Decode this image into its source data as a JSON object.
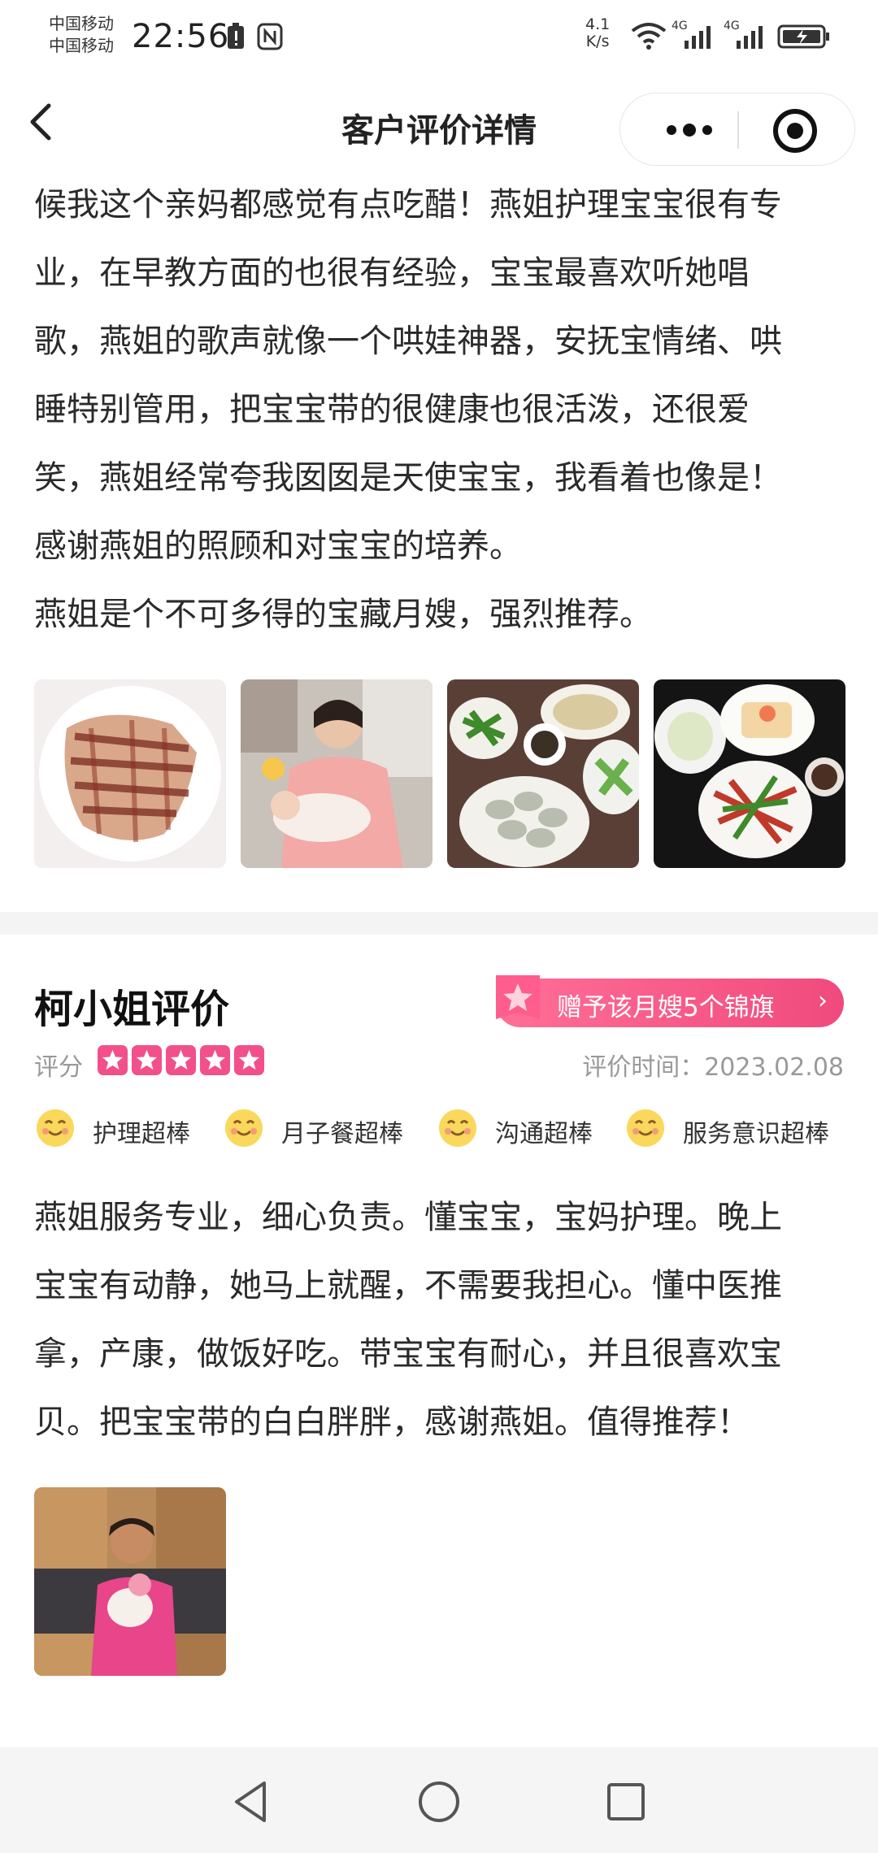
{
  "status_bar": {
    "carrier_1": "中国移动",
    "carrier_2": "中国移动",
    "time": "22:56",
    "net_speed_value": "4.1",
    "net_speed_unit": "K/s",
    "signal_1_label": "4G",
    "signal_2_label": "4G"
  },
  "nav": {
    "title": "客户评价详情",
    "back_icon": "chevron-left-icon",
    "more_icon": "more-dots-icon",
    "close_icon": "target-icon"
  },
  "review_1": {
    "lines": [
      "候我这个亲妈都感觉有点吃醋！燕姐护理宝宝很有专",
      "业，在早教方面的也很有经验，宝宝最喜欢听她唱",
      "歌，燕姐的歌声就像一个哄娃神器，安抚宝情绪、哄",
      "睡特别管用，把宝宝带的很健康也很活泼，还很爱",
      "笑，燕姐经常夸我囡囡是天使宝宝，我看着也像是！",
      "感谢燕姐的照顾和对宝宝的培养。",
      "燕姐是个不可多得的宝藏月嫂，强烈推荐。"
    ],
    "photos": [
      "photo-food-meat",
      "photo-mother-baby",
      "photo-meal-dumplings",
      "photo-meal-dishes"
    ]
  },
  "review_2": {
    "reviewer": "柯小姐评价",
    "flag_button": "赠予该月嫂5个锦旗",
    "flag_chevron": "›",
    "score_label": "评分",
    "rating": 5,
    "rating_max": 5,
    "time_label": "评价时间：",
    "time_value": "2023.02.08",
    "tags": [
      "护理超棒",
      "月子餐超棒",
      "沟通超棒",
      "服务意识超棒"
    ],
    "lines": [
      "燕姐服务专业，细心负责。懂宝宝，宝妈护理。晚上",
      "宝宝有动静，她马上就醒，不需要我担心。懂中医推",
      "拿，产康，做饭好吃。带宝宝有耐心，并且很喜欢宝",
      "贝。把宝宝带的白白胖胖，感谢燕姐。值得推荐！"
    ],
    "photos": [
      "photo-nanny-holding-baby"
    ]
  },
  "bottom_nav": {
    "back": "triangle-back-icon",
    "home": "circle-home-icon",
    "recents": "square-recents-icon"
  },
  "colors": {
    "accent": "#f2508a",
    "text": "#2a2a2a",
    "muted": "#999999"
  }
}
